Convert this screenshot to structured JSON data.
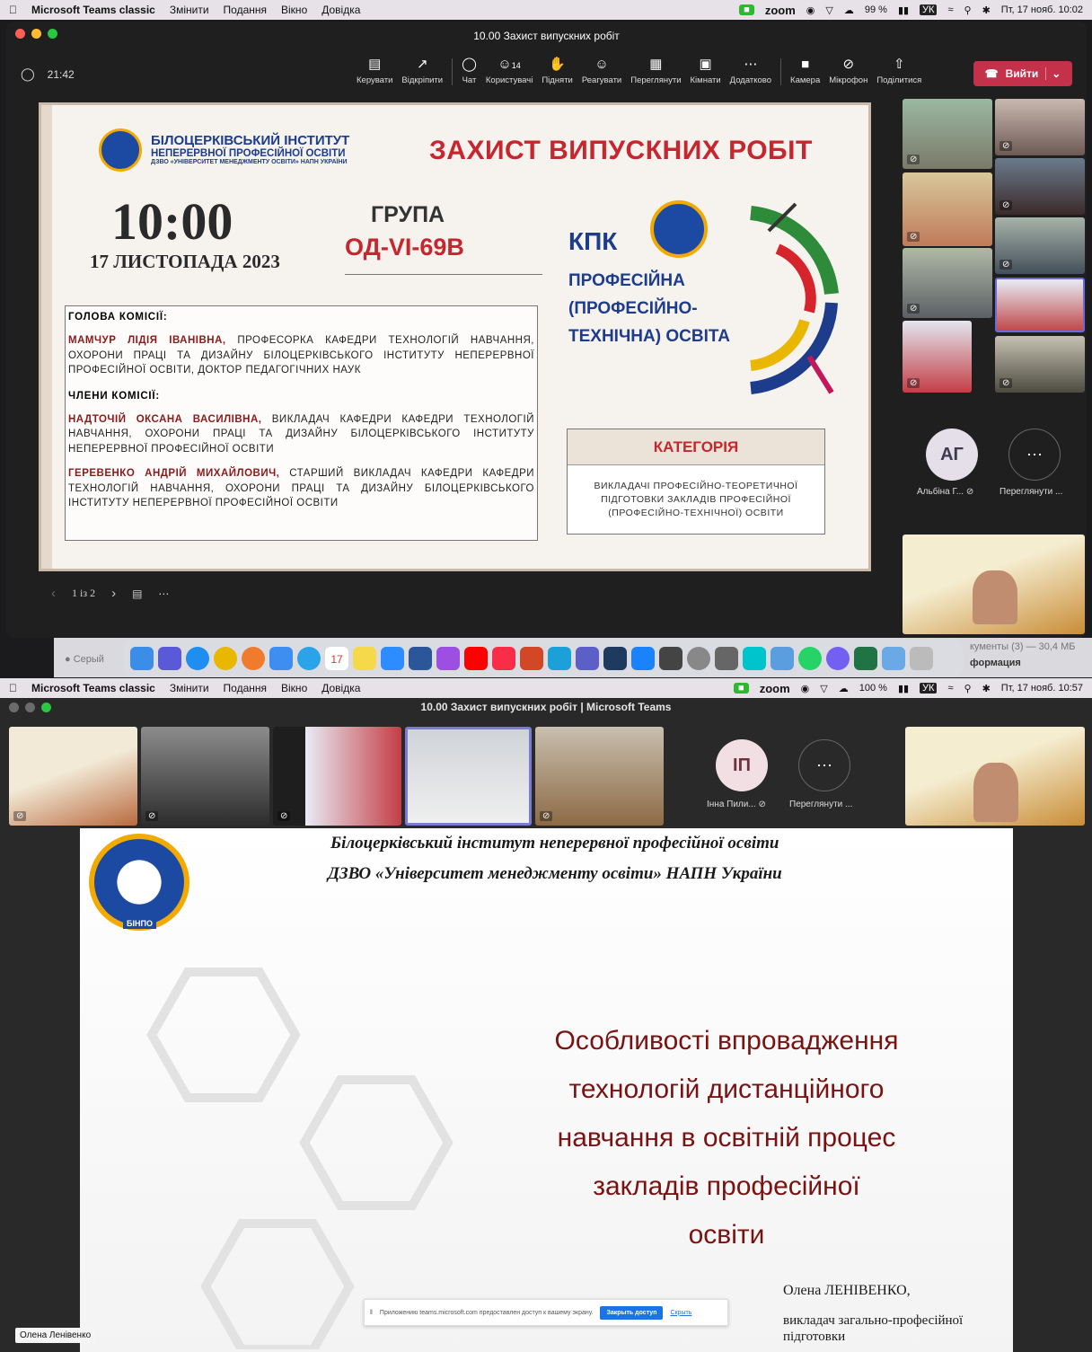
{
  "top": {
    "menubar": {
      "app": "Microsoft Teams classic",
      "items": [
        "Змінити",
        "Подання",
        "Вікно",
        "Довідка"
      ],
      "zoom": "zoom",
      "battery": "99 %",
      "lang": "УК",
      "datetime": "Пт, 17 нояб.  10:02"
    },
    "window_title": "10.00 Захист випускних робіт",
    "timer": "21:42",
    "toolbar": [
      "Керувати",
      "Відкріпити",
      "Чат",
      "Користувачі",
      "Підняти",
      "Реагувати",
      "Переглянути",
      "Кімнати",
      "Додатково",
      "Камера",
      "Мікрофон",
      "Поділитися"
    ],
    "participants_count": "14",
    "leave": "Вийти",
    "slide": {
      "inst1": "БІЛОЦЕРКІВСЬКИЙ ІНСТИТУТ",
      "inst2": "НЕПЕРЕРВНОЇ ПРОФЕСІЙНОЇ ОСВІТИ",
      "inst3": "ДЗВО «УНІВЕРСИТЕТ МЕНЕДЖМЕНТУ ОСВІТИ» НАПН УКРАЇНИ",
      "heading": "ЗАХИСТ ВИПУСКНИХ РОБІТ",
      "time": "10:00",
      "date": "17 ЛИСТОПАДА 2023",
      "group_label": "ГРУПА",
      "group": "ОД-VI-69В",
      "kpk": "КПК",
      "prof1": "ПРОФЕСІЙНА",
      "prof2": "(ПРОФЕСІЙНО-",
      "prof3": "ТЕХНІЧНА) ОСВІТА",
      "chair_label": "ГОЛОВА КОМІСІЇ:",
      "chair_name": "МАМЧУР ЛІДІЯ ІВАНІВНА,",
      "chair_text": " ПРОФЕСОРКА КАФЕДРИ ТЕХНОЛОГІЙ НАВЧАННЯ, ОХОРОНИ ПРАЦІ ТА ДИЗАЙНУ БІЛОЦЕРКІВСЬКОГО ІНСТИТУТУ НЕПЕРЕРВНОЇ ПРОФЕСІЙНОЇ ОСВІТИ, ДОКТОР ПЕДАГОГІЧНИХ НАУК",
      "members_label": "ЧЛЕНИ КОМІСІЇ:",
      "m1_name": "НАДТОЧІЙ ОКСАНА ВАСИЛІВНА,",
      "m1_text": " ВИКЛАДАЧ КАФЕДРИ КАФЕДРИ ТЕХНОЛОГІЙ НАВЧАННЯ, ОХОРОНИ ПРАЦІ ТА ДИЗАЙНУ БІЛОЦЕРКІВСЬКОГО ІНСТИТУТУ НЕПЕРЕРВНОЇ ПРОФЕСІЙНОЇ ОСВІТИ",
      "m2_name": "ГЕРЕВЕНКО АНДРІЙ МИХАЙЛОВИЧ,",
      "m2_text": " СТАРШИЙ ВИКЛАДАЧ КАФЕДРИ КАФЕДРИ ТЕХНОЛОГІЙ НАВЧАННЯ, ОХОРОНИ ПРАЦІ ТА ДИЗАЙНУ БІЛОЦЕРКІВСЬКОГО ІНСТИТУТУ НЕПЕРЕРВНОЇ ПРОФЕСІЙНОЇ ОСВІТИ",
      "category_label": "КАТЕГОРІЯ",
      "category_text": "ВИКЛАДАЧІ ПРОФЕСІЙНО-ТЕОРЕТИЧНОЇ ПІДГОТОВКИ ЗАКЛАДІВ ПРОФЕСІЙНОЇ (ПРОФЕСІЙНО-ТЕХНІЧНОЇ) ОСВІТИ"
    },
    "pager": "1 із 2",
    "avatar_initials": "АГ",
    "avatar_name": "Альбіна Г...",
    "more_label": "Переглянути ...",
    "finder_left": "Серый",
    "finder_right1": "кументы (3) — 30,4 МБ",
    "finder_right2": "формация",
    "dock_date": "17"
  },
  "bottom": {
    "menubar": {
      "app": "Microsoft Teams classic",
      "items": [
        "Змінити",
        "Подання",
        "Вікно",
        "Довідка"
      ],
      "zoom": "zoom",
      "battery": "100 %",
      "lang": "УК",
      "datetime": "Пт, 17 нояб.  10:57"
    },
    "window_title": "10.00 Захист випускних робіт | Microsoft Teams",
    "avatar_initials": "ІП",
    "avatar_name": "Інна Пили...",
    "more_label": "Переглянути ...",
    "slide": {
      "line1": "Білоцерківський інститут неперервної професійної освіти",
      "line2": "ДЗВО «Університет менеджменту освіти» НАПН України",
      "logo_text": "БІНПО",
      "title1": "Особливості впровадження",
      "title2": "технологій дистанційного",
      "title3": "навчання в освітній процес",
      "title4": "закладів професійної",
      "title5": "освіти",
      "author": "Олена ЛЕНІВЕНКО,",
      "role1": "викладач загально-професійної",
      "role2": "підготовки"
    },
    "share_notice": "Приложению teams.microsoft.com предоставлен доступ к вашему экрану.",
    "share_stop": "Закрыть доступ",
    "share_hide": "Скрыть",
    "presenter": "Олена Ленівенко"
  }
}
